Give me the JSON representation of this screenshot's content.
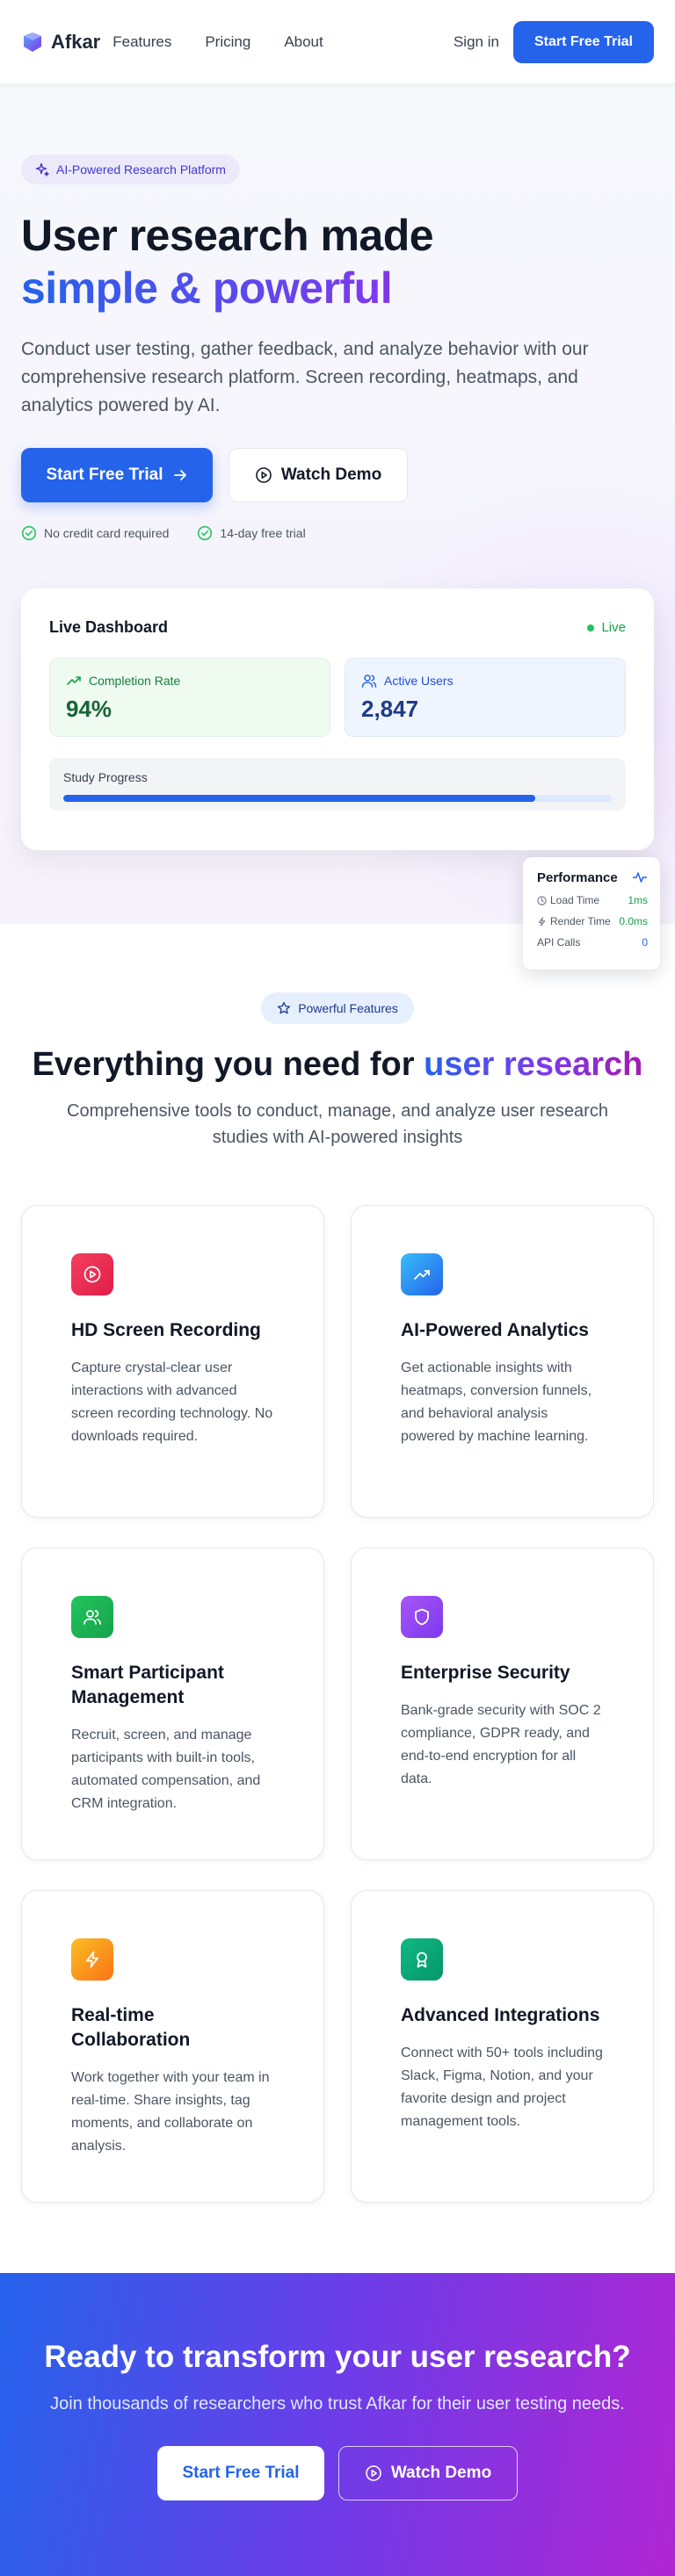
{
  "nav": {
    "brand": "Afkar",
    "links": [
      "Features",
      "Pricing",
      "About"
    ],
    "signin": "Sign in",
    "cta": "Start Free Trial"
  },
  "hero": {
    "badge": "AI-Powered Research Platform",
    "title_line1": "User research made",
    "title_line2": "simple & powerful",
    "subtitle": "Conduct user testing, gather feedback, and analyze behavior with our comprehensive research platform. Screen recording, heatmaps, and analytics powered by AI.",
    "primary_cta": "Start Free Trial",
    "secondary_cta": "Watch Demo",
    "checks": [
      "No credit card required",
      "14-day free trial"
    ]
  },
  "dashboard": {
    "title": "Live Dashboard",
    "status": "Live",
    "stats": [
      {
        "label": "Completion Rate",
        "value": "94%"
      },
      {
        "label": "Active Users",
        "value": "2,847"
      }
    ],
    "progress_label": "Study Progress",
    "progress_fraction": 0.86
  },
  "performance": {
    "title": "Performance",
    "rows": [
      {
        "label": "Load Time",
        "value": "1ms"
      },
      {
        "label": "Render Time",
        "value": "0.0ms"
      },
      {
        "label": "API Calls",
        "value": "0"
      }
    ]
  },
  "features": {
    "badge": "Powerful Features",
    "title_prefix": "Everything you need for ",
    "title_accent": "user research",
    "subtitle": "Comprehensive tools to conduct, manage, and analyze user research studies with AI-powered insights",
    "cards": [
      {
        "title": "HD Screen Recording",
        "desc": "Capture crystal-clear user interactions with advanced screen recording technology. No downloads required.",
        "icon": "play-circle-icon",
        "color": "#e11d48"
      },
      {
        "title": "AI-Powered Analytics",
        "desc": "Get actionable insights with heatmaps, conversion funnels, and behavioral analysis powered by machine learning.",
        "icon": "trending-up-icon",
        "color": "#0ea5e9"
      },
      {
        "title": "Smart Participant Management",
        "desc": "Recruit, screen, and manage participants with built-in tools, automated compensation, and CRM integration.",
        "icon": "users-icon",
        "color": "#22c55e"
      },
      {
        "title": "Enterprise Security",
        "desc": "Bank-grade security with SOC 2 compliance, GDPR ready, and end-to-end encryption for all data.",
        "icon": "shield-icon",
        "color": "#8b5cf6"
      },
      {
        "title": "Real-time Collaboration",
        "desc": "Work together with your team in real-time. Share insights, tag moments, and collaborate on analysis.",
        "icon": "lightning-icon",
        "color": "#f59e0b"
      },
      {
        "title": "Advanced Integrations",
        "desc": "Connect with 50+ tools including Slack, Figma, Notion, and your favorite design and project management tools.",
        "icon": "award-icon",
        "color": "#10b981"
      }
    ]
  },
  "cta": {
    "title": "Ready to transform your user research?",
    "subtitle": "Join thousands of researchers who trust Afkar for their user testing needs.",
    "primary": "Start Free Trial",
    "secondary": "Watch Demo"
  },
  "colors": {
    "primary": "#2563eb",
    "accent_purple": "#7c3aed",
    "accent_magenta": "#a21caf",
    "success": "#16a34a"
  }
}
